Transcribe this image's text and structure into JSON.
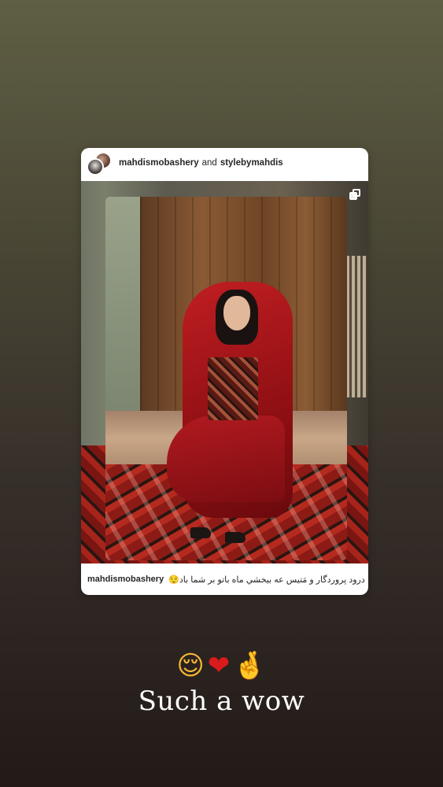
{
  "post": {
    "author": "mahdismobashery",
    "joiner": "and",
    "collaborator": "stylebymahdis",
    "caption_user": "mahdismobashery",
    "caption_text": "درود پروردگار و مَتیس عه بیخشي ماه باتو بر شما باد😌",
    "multi_image_icon": "carousel-icon"
  },
  "story": {
    "emojis": [
      "😌",
      "❤",
      "🤞"
    ],
    "text": "Such a wow"
  }
}
